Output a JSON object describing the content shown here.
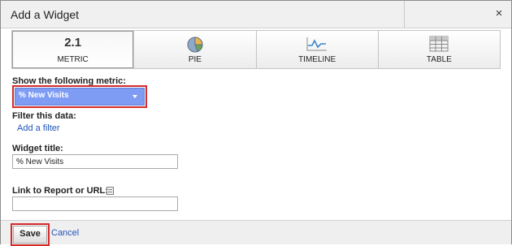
{
  "window": {
    "title": "Add a Widget",
    "close_label": "×"
  },
  "tabs": [
    {
      "label": "METRIC",
      "glyph": "2.1",
      "icon": "metric-icon",
      "active": true
    },
    {
      "label": "PIE",
      "icon": "pie-chart-icon",
      "active": false
    },
    {
      "label": "TIMELINE",
      "icon": "timeline-icon",
      "active": false
    },
    {
      "label": "TABLE",
      "icon": "table-icon",
      "active": false
    }
  ],
  "metric": {
    "label": "Show the following metric:",
    "selected": "% New Visits"
  },
  "filter": {
    "label": "Filter this data:",
    "add_link": "Add a filter"
  },
  "widget_title": {
    "label": "Widget title:",
    "value": "% New Visits"
  },
  "link": {
    "label": "Link to Report or URL:",
    "value": ""
  },
  "footer": {
    "save_label": "Save",
    "cancel_label": "Cancel"
  },
  "colors": {
    "select_bg": "#7f9cf5",
    "highlight_border": "#d62a2a",
    "link": "#2255bb"
  }
}
